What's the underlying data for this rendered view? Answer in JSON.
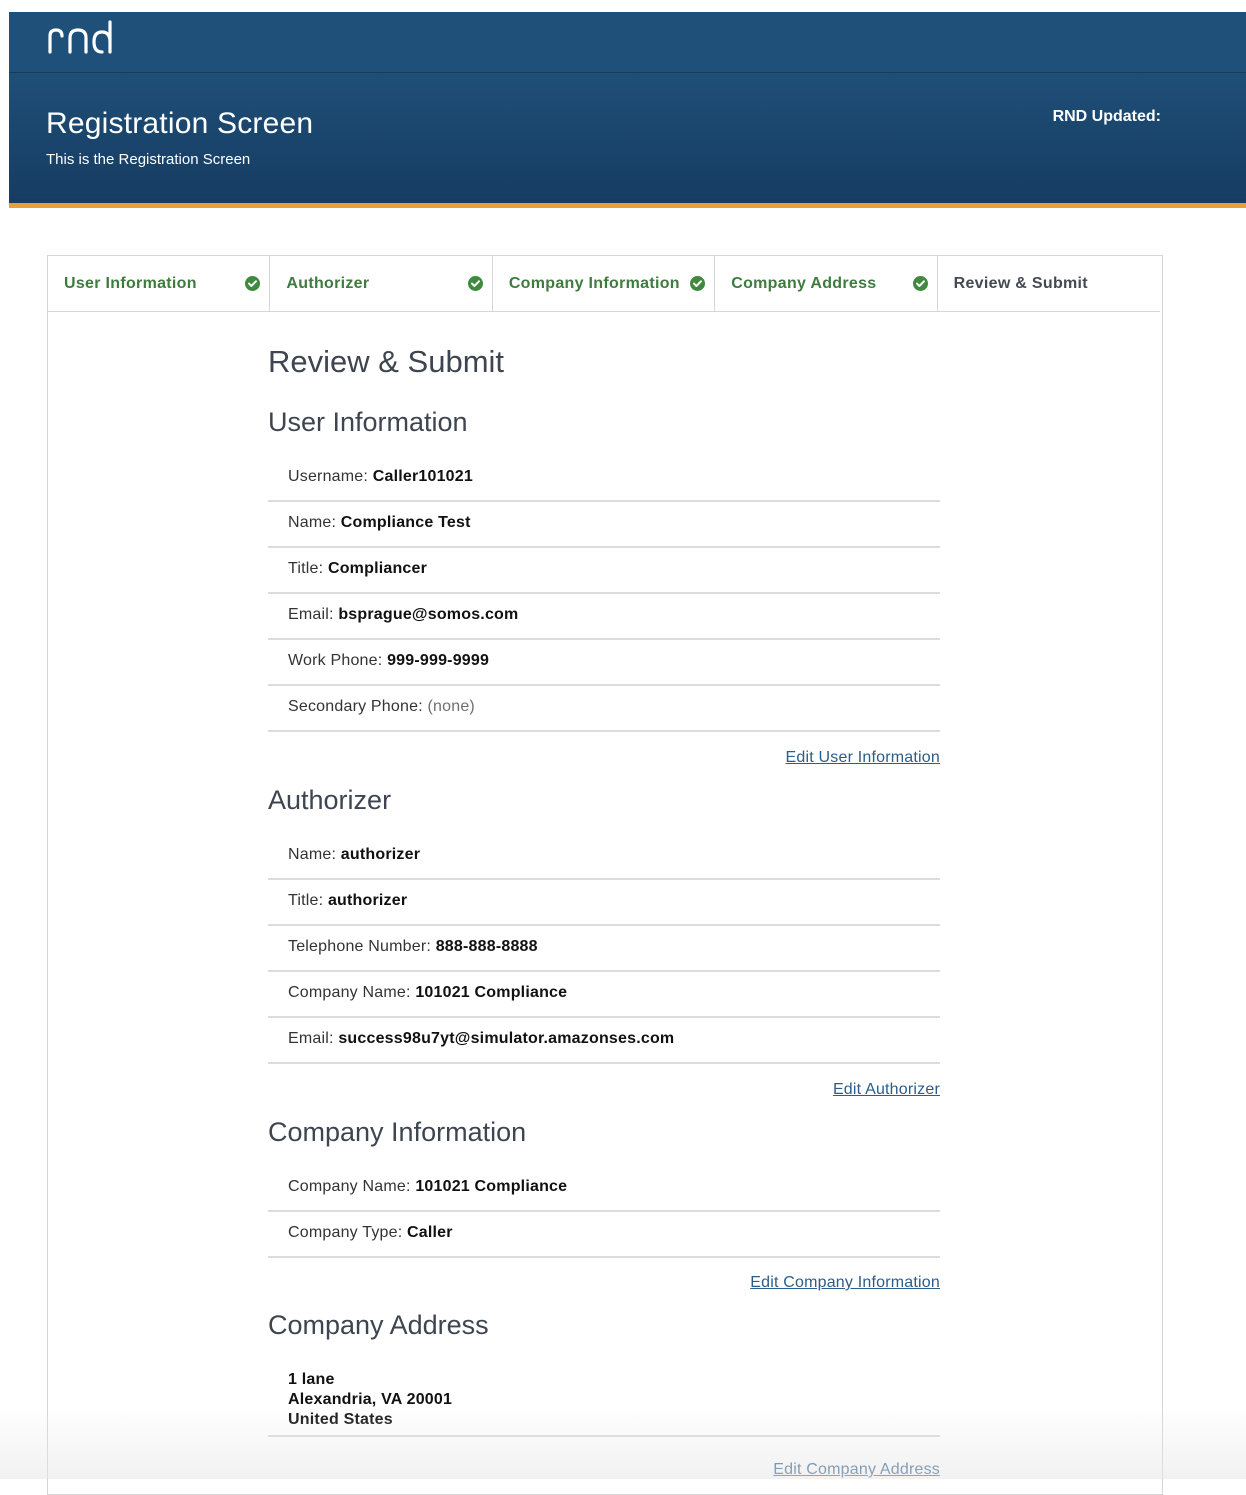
{
  "header": {
    "logo_text": "rnd",
    "title": "Registration Screen",
    "subtitle": "This is the Registration Screen",
    "updated_label": "RND Updated:"
  },
  "colors": {
    "header_bg": "#1f4f77",
    "header_accent": "#e3a138",
    "step_complete": "#3f7b3f",
    "link": "#2b5d8a"
  },
  "steps": [
    {
      "label": "User Information",
      "status": "complete",
      "icon": "check-circle-icon"
    },
    {
      "label": "Authorizer",
      "status": "complete",
      "icon": "check-circle-icon"
    },
    {
      "label": "Company Information",
      "status": "complete",
      "icon": "check-circle-icon"
    },
    {
      "label": "Company Address",
      "status": "complete",
      "icon": "check-circle-icon"
    },
    {
      "label": "Review & Submit",
      "status": "active"
    }
  ],
  "review": {
    "title": "Review & Submit",
    "user_info": {
      "title": "User Information",
      "fields": [
        {
          "label": "Username:",
          "value": "Caller101021"
        },
        {
          "label": "Name:",
          "value": "Compliance Test"
        },
        {
          "label": "Title:",
          "value": "Compliancer"
        },
        {
          "label": "Email:",
          "value": "bsprague@somos.com"
        },
        {
          "label": "Work Phone:",
          "value": "999-999-9999"
        },
        {
          "label": "Secondary Phone:",
          "value": "(none)"
        }
      ],
      "edit_label": "Edit User Information"
    },
    "authorizer": {
      "title": "Authorizer",
      "fields": [
        {
          "label": "Name:",
          "value": "authorizer"
        },
        {
          "label": "Title:",
          "value": "authorizer"
        },
        {
          "label": "Telephone Number:",
          "value": "888-888-8888"
        },
        {
          "label": "Company Name:",
          "value": "101021 Compliance"
        },
        {
          "label": "Email:",
          "value": "success98u7yt@simulator.amazonses.com"
        }
      ],
      "edit_label": "Edit Authorizer"
    },
    "company_info": {
      "title": "Company Information",
      "fields": [
        {
          "label": "Company Name:",
          "value": "101021 Compliance"
        },
        {
          "label": "Company Type:",
          "value": "Caller"
        }
      ],
      "edit_label": "Edit Company Information"
    },
    "company_address": {
      "title": "Company Address",
      "lines": [
        "1 lane",
        "Alexandria, VA 20001",
        "United States"
      ],
      "edit_label": "Edit Company Address"
    }
  }
}
